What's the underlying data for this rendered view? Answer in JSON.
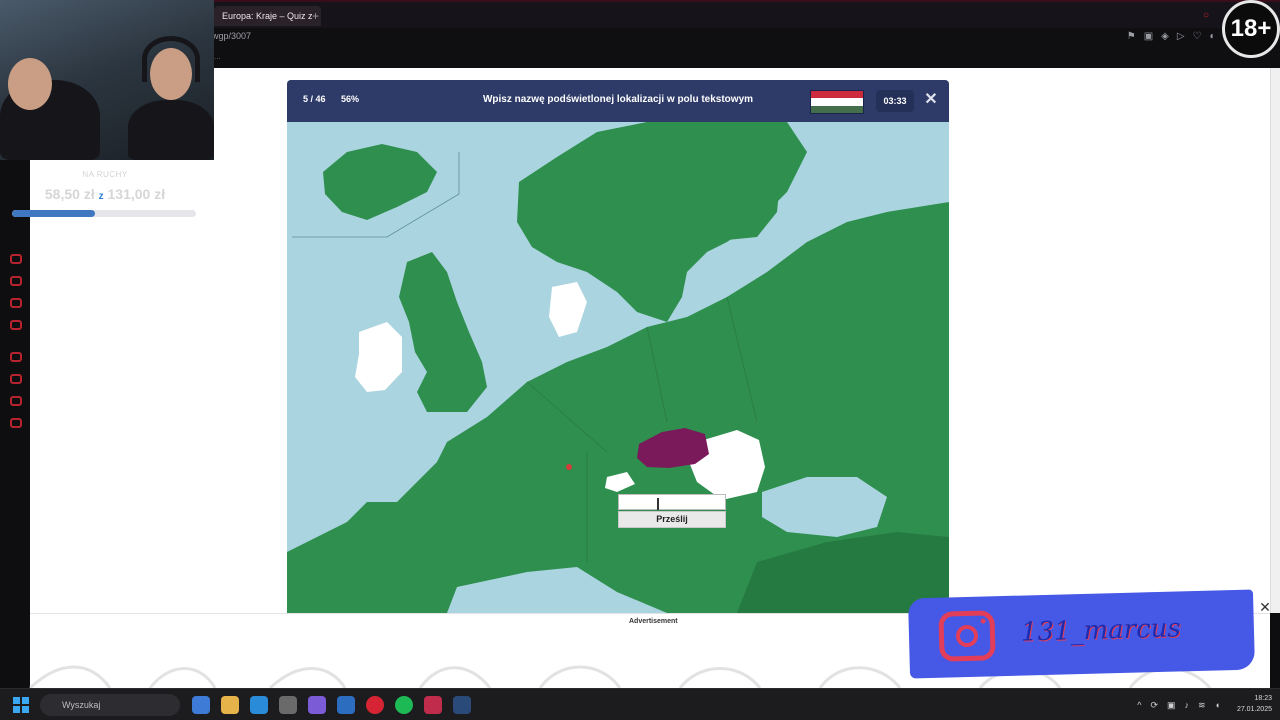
{
  "browser": {
    "tab_title": "Europa: Kraje – Quiz z",
    "new_tab_icon": "plus-icon",
    "url_fragment": "wgp/3007",
    "bookmarks_text": "...",
    "toolbar_icons": [
      "pin-icon",
      "screenshot-icon",
      "shield-icon",
      "play-icon",
      "heart-icon",
      "account-icon",
      "download-icon"
    ]
  },
  "age_badge": "18+",
  "stream": {
    "goal_label": "NA RUCHY",
    "goal_current": "58,50 zł",
    "goal_joiner": "z",
    "goal_total": "131,00 zł",
    "goal_progress": 0.45
  },
  "quiz": {
    "progress": "5 / 46",
    "percent": "56%",
    "prompt": "Wpisz nazwę podświetlonej lokalizacji w polu tekstowym",
    "flag_colors": [
      "#cd2a3e",
      "#ffffff",
      "#436f4d"
    ],
    "timer": "03:33",
    "close_label": "✕",
    "submit_label": "Prześlij",
    "answer_value": ""
  },
  "map_colors": {
    "sea": "#aad4df",
    "land": "#2f8f4f",
    "land_dark": "#257a42",
    "answered": "#ffffff",
    "highlight": "#7a1a5a"
  },
  "ad": {
    "label": "Advertisement",
    "close_label": "✕"
  },
  "overlay": {
    "instagram_handle": "131_marcus"
  },
  "taskbar": {
    "search_placeholder": "Wyszukaj",
    "apps": [
      "copilot-icon",
      "explorer-icon",
      "edge-icon",
      "calculator-icon",
      "camera-icon",
      "mail-icon",
      "opera-icon",
      "spotify-icon",
      "music-icon",
      "steam-icon"
    ],
    "clock_time": "18:23",
    "clock_date": "27.01.2025"
  }
}
